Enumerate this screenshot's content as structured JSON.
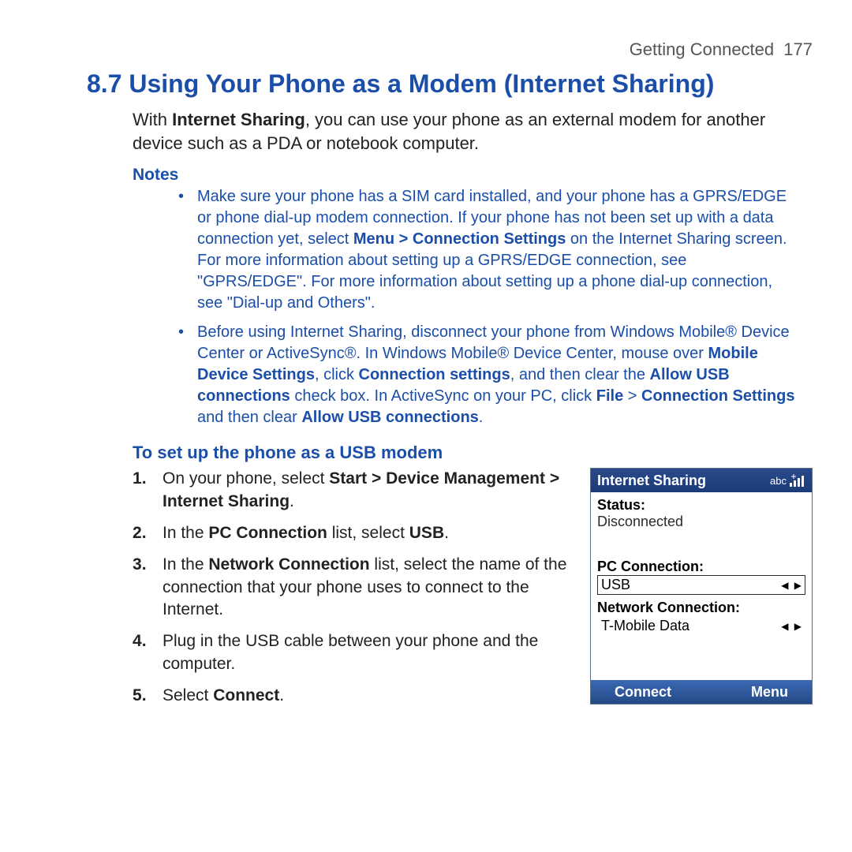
{
  "header": {
    "section": "Getting Connected",
    "page": "177"
  },
  "title": "8.7  Using Your Phone as a Modem (Internet Sharing)",
  "intro_pre": "With ",
  "intro_bold": "Internet Sharing",
  "intro_post": ", you can use your phone as an external modem for another device such as a PDA or notebook computer.",
  "notes_label": "Notes",
  "notes": [
    {
      "pre": "Make sure your phone has a SIM card installed, and your phone has a GPRS/EDGE or phone dial-up modem connection. If your phone has not been set up with a data connection yet, select ",
      "b1": "Menu > Connection Settings",
      "post": " on the Internet Sharing screen. For more information about setting up a GPRS/EDGE connection, see \"GPRS/EDGE\". For more information about setting up a phone dial-up connection, see \"Dial-up and Others\"."
    },
    {
      "pre": "Before using Internet Sharing, disconnect your phone from Windows Mobile® Device Center or ActiveSync®. In Windows Mobile® Device Center, mouse over ",
      "b1": "Mobile Device Settings",
      "mid1": ", click ",
      "b2": "Connection settings",
      "mid2": ", and then clear the ",
      "b3": "Allow USB connections",
      "mid3": " check box. In ActiveSync on your PC, click ",
      "b4": "File",
      "mid4": " > ",
      "b5": "Connection Settings",
      "mid5": " and then clear ",
      "b6": "Allow USB connections",
      "post": "."
    }
  ],
  "subheading": "To set up the phone as a USB modem",
  "steps": [
    {
      "pre": "On your phone, select ",
      "b1": "Start > Device Management > Internet Sharing",
      "post": "."
    },
    {
      "pre": "In the ",
      "b1": "PC Connection",
      "mid": " list, select ",
      "b2": "USB",
      "post": "."
    },
    {
      "pre": "In the ",
      "b1": "Network Connection",
      "post": " list, select the name of the connection that your phone uses to connect to the Internet."
    },
    {
      "pre": "Plug in the USB cable between your phone and the computer."
    },
    {
      "pre": "Select ",
      "b1": "Connect",
      "post": "."
    }
  ],
  "phone": {
    "title": "Internet Sharing",
    "indicator": "abc",
    "status_label": "Status:",
    "status_value": "Disconnected",
    "pc_label": "PC Connection:",
    "pc_value": "USB",
    "net_label": "Network Connection:",
    "net_value": "T-Mobile Data",
    "softkey_left": "Connect",
    "softkey_right": "Menu"
  }
}
